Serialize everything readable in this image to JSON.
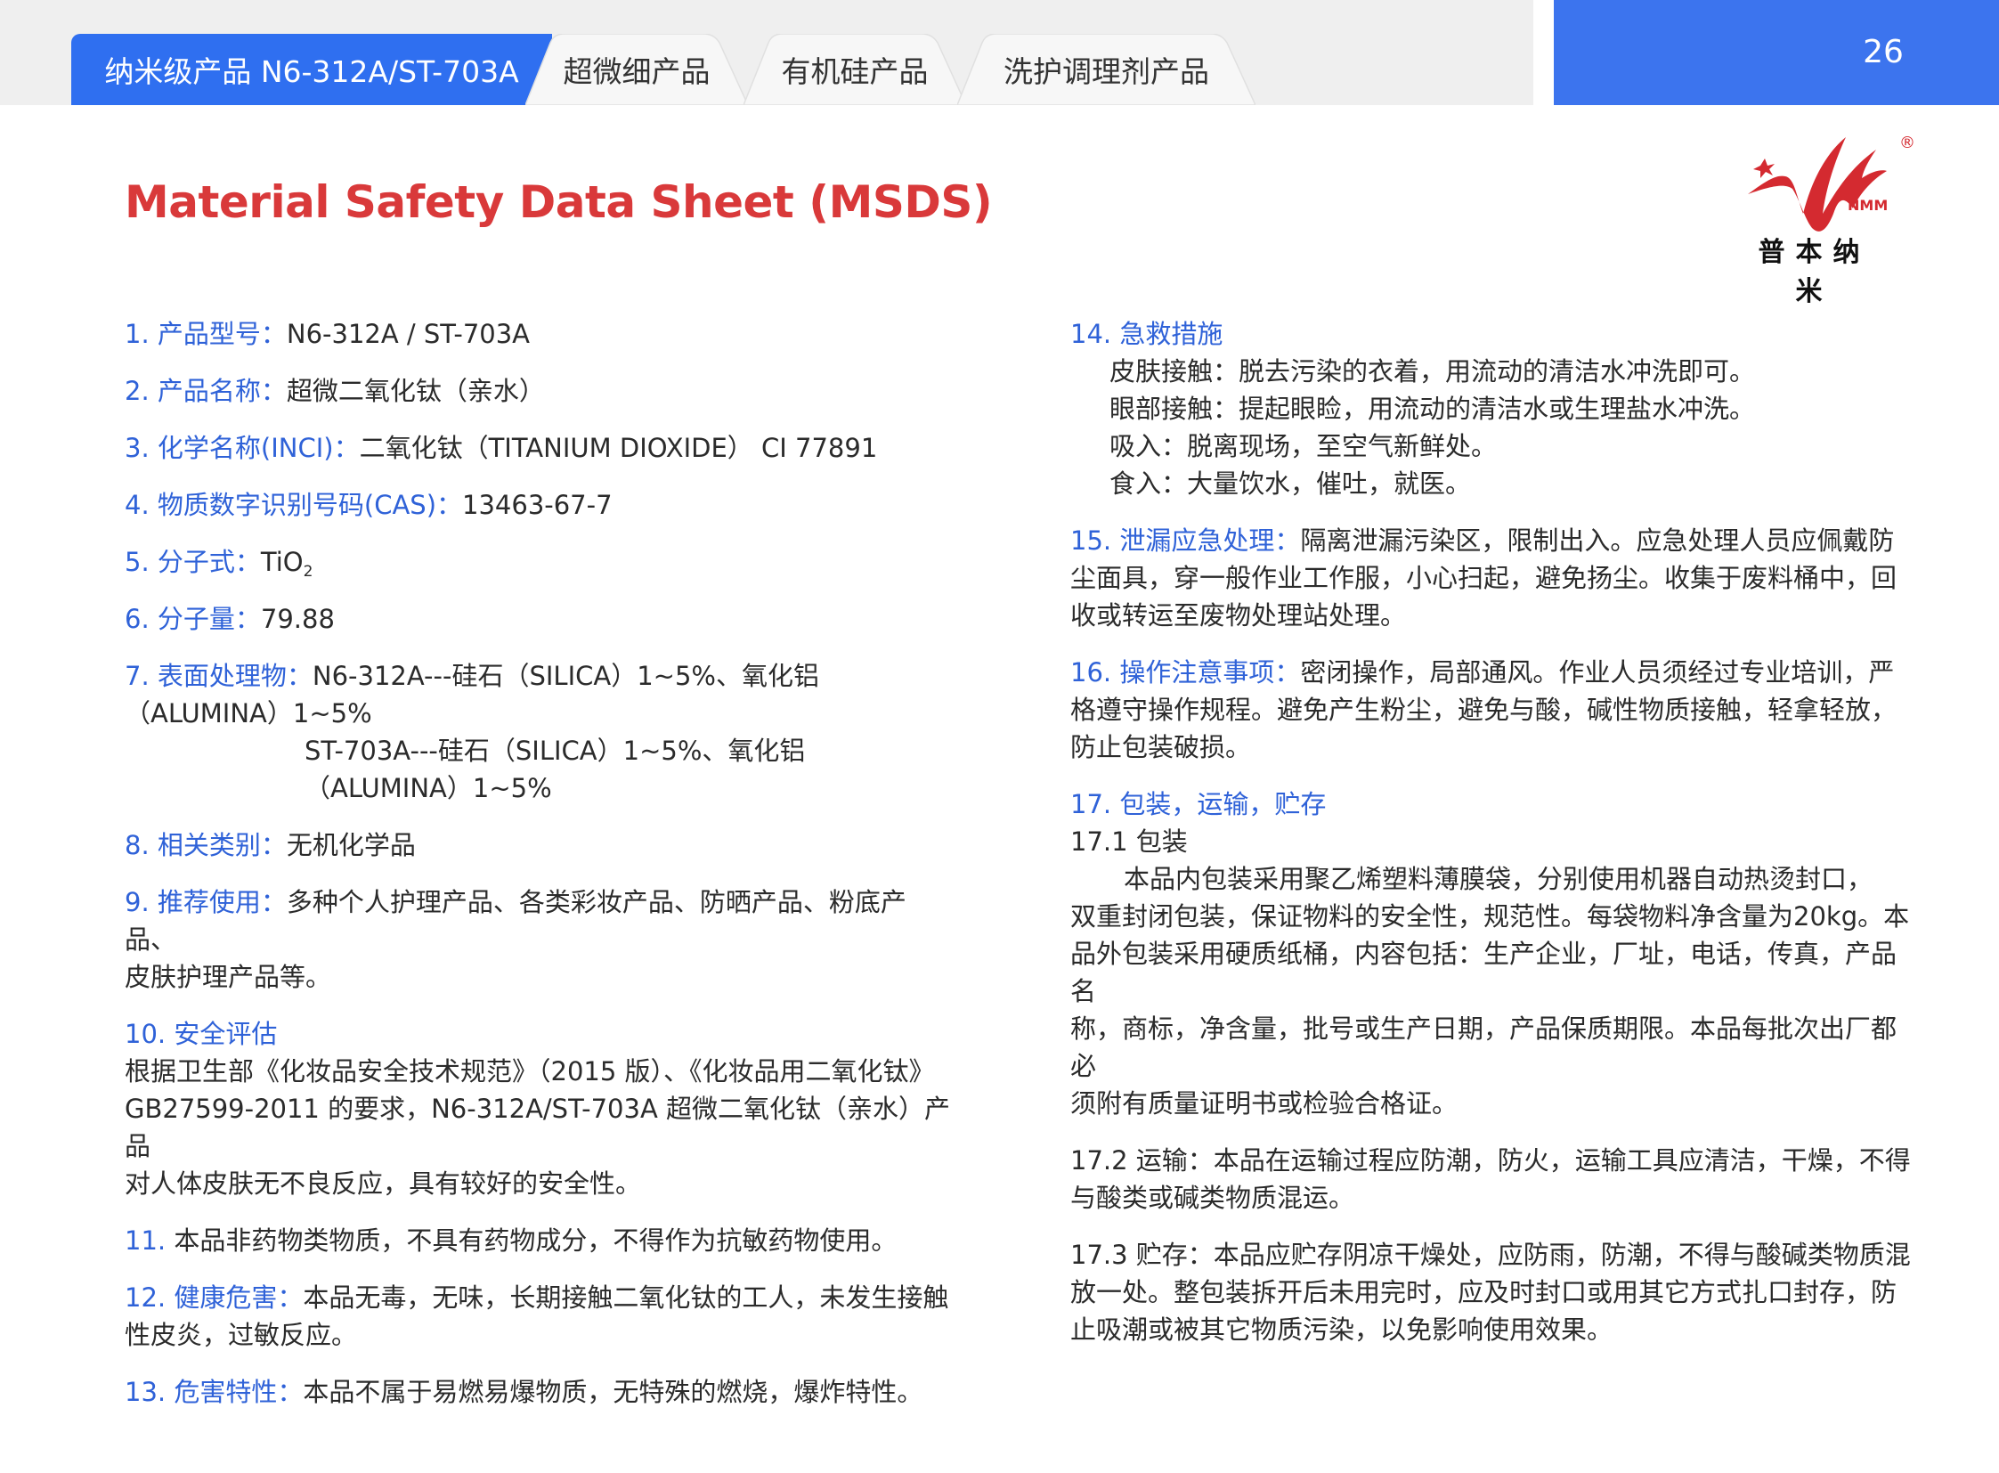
{
  "tabs": [
    {
      "label": "纳米级产品 N6-312A/ST-703A",
      "active": true
    },
    {
      "label": "超微细产品",
      "active": false
    },
    {
      "label": "有机硅产品",
      "active": false
    },
    {
      "label": "洗护调理剂产品",
      "active": false
    }
  ],
  "page_number": "26",
  "logo": {
    "text": "NMM",
    "cn": "普本纳米",
    "registered": "®",
    "color": "#d42a30"
  },
  "title": "Material Safety Data Sheet (MSDS)",
  "colors": {
    "accent_blue": "#2f6ff0",
    "label_blue": "#2f62d8",
    "title_red": "#d9393a"
  },
  "left": {
    "item1": {
      "label": "1. 产品型号：",
      "value": "N6-312A / ST-703A"
    },
    "item2": {
      "label": "2. 产品名称：",
      "value": "超微二氧化钛（亲水）"
    },
    "item3": {
      "label": "3. 化学名称(INCI)：",
      "value": "二氧化钛（TITANIUM DIOXIDE） CI 77891"
    },
    "item4": {
      "label": "4. 物质数字识别号码(CAS)：",
      "value": "13463-67-7"
    },
    "item5": {
      "label": "5. 分子式：",
      "value": "TiO",
      "sub": "2"
    },
    "item6": {
      "label": "6. 分子量：",
      "value": "79.88"
    },
    "item7": {
      "label": "7. 表面处理物：",
      "line1": "N6-312A---硅石（SILICA）1~5%、氧化铝（ALUMINA）1~5%",
      "line2": "ST-703A---硅石（SILICA）1~5%、氧化铝（ALUMINA）1~5%"
    },
    "item8": {
      "label": "8. 相关类别：",
      "value": "无机化学品"
    },
    "item9": {
      "label": "9. 推荐使用：",
      "line1": "多种个人护理产品、各类彩妆产品、防晒产品、粉底产品、",
      "line2": "皮肤护理产品等。"
    },
    "item10": {
      "label": "10. 安全评估",
      "line1": "根据卫生部《化妆品安全技术规范》（2015 版）、《化妆品用二氧化钛》",
      "line2": "GB27599-2011 的要求，N6-312A/ST-703A 超微二氧化钛（亲水）产品",
      "line3": "对人体皮肤无不良反应，具有较好的安全性。"
    },
    "item11": {
      "label": "11. ",
      "value": "本品非药物类物质，不具有药物成分，不得作为抗敏药物使用。"
    },
    "item12": {
      "label": "12. 健康危害：",
      "line1": "本品无毒，无味，长期接触二氧化钛的工人，未发生接触",
      "line2": "性皮炎，过敏反应。"
    },
    "item13": {
      "label": "13. 危害特性：",
      "value": "本品不属于易燃易爆物质，无特殊的燃烧，爆炸特性。"
    }
  },
  "right": {
    "item14": {
      "label": "14. 急救措施",
      "line1": "皮肤接触：脱去污染的衣着，用流动的清洁水冲洗即可。",
      "line2": "眼部接触：提起眼睑，用流动的清洁水或生理盐水冲洗。",
      "line3": "吸入：脱离现场，至空气新鲜处。",
      "line4": "食入：大量饮水，催吐，就医。"
    },
    "item15": {
      "label": "15. 泄漏应急处理：",
      "line1": "隔离泄漏污染区，限制出入。应急处理人员应佩戴防",
      "line2": "尘面具，穿一般作业工作服，小心扫起，避免扬尘。收集于废料桶中，回",
      "line3": "收或转运至废物处理站处理。"
    },
    "item16": {
      "label": "16. 操作注意事项：",
      "line1": "密闭操作，局部通风。作业人员须经过专业培训，严",
      "line2": "格遵守操作规程。避免产生粉尘，避免与酸，碱性物质接触，轻拿轻放，",
      "line3": "防止包装破损。"
    },
    "item17": {
      "label": "17. 包装，运输，贮存",
      "s1_title": "17.1 包装",
      "s1_line1": "本品内包装采用聚乙烯塑料薄膜袋，分别使用机器自动热烫封口，",
      "s1_line2": "双重封闭包装，保证物料的安全性，规范性。每袋物料净含量为20kg。本",
      "s1_line3": "品外包装采用硬质纸桶，内容包括：生产企业，厂址，电话，传真，产品名",
      "s1_line4": "称，商标，净含量，批号或生产日期，产品保质期限。本品每批次出厂都必",
      "s1_line5": "须附有质量证明书或检验合格证。",
      "s2_line1": "17.2 运输：本品在运输过程应防潮，防火，运输工具应清洁，干燥，不得",
      "s2_line2": "与酸类或碱类物质混运。",
      "s3_line1": "17.3 贮存：本品应贮存阴凉干燥处，应防雨，防潮，不得与酸碱类物质混",
      "s3_line2": "放一处。整包装拆开后未用完时，应及时封口或用其它方式扎口封存，防",
      "s3_line3": "止吸潮或被其它物质污染，以免影响使用效果。"
    }
  }
}
